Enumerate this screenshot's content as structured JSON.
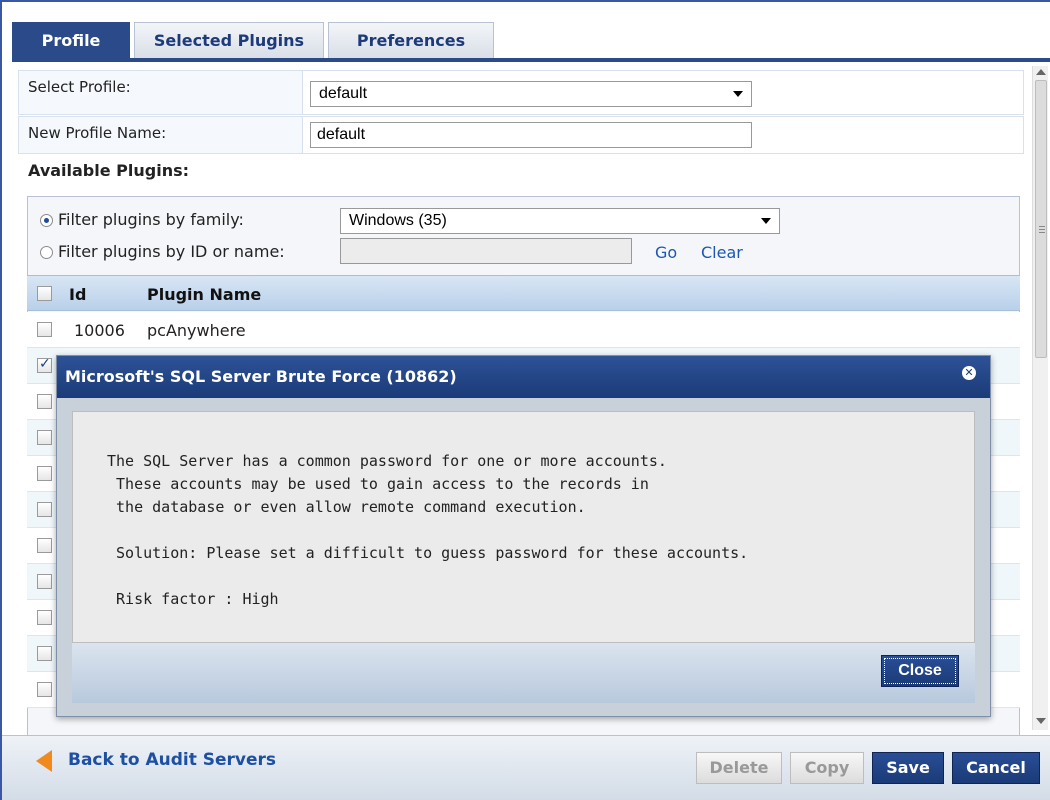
{
  "tabs": [
    {
      "label": "Profile"
    },
    {
      "label": "Selected Plugins"
    },
    {
      "label": "Preferences"
    }
  ],
  "form": {
    "select_profile_label": "Select Profile:",
    "select_profile_value": "default",
    "new_profile_label": "New Profile Name:",
    "new_profile_value": "default",
    "available_plugins_title": "Available Plugins:"
  },
  "filter": {
    "by_family_label": "Filter plugins by family:",
    "family_value": "Windows (35)",
    "by_id_label": "Filter plugins by ID or name:",
    "id_value": "",
    "go_label": "Go",
    "clear_label": "Clear"
  },
  "table": {
    "headers": {
      "id": "Id",
      "name": "Plugin Name"
    },
    "rows": [
      {
        "id": "10006",
        "name": "pcAnywhere",
        "checked": false
      },
      {
        "id": "",
        "name": "",
        "checked": true
      },
      {
        "id": "",
        "name": "",
        "checked": false
      },
      {
        "id": "",
        "name": "",
        "checked": false
      },
      {
        "id": "",
        "name": "",
        "checked": false
      },
      {
        "id": "",
        "name": "",
        "checked": false
      },
      {
        "id": "",
        "name": "",
        "checked": false
      },
      {
        "id": "",
        "name": "",
        "checked": false
      },
      {
        "id": "",
        "name": "",
        "checked": false
      },
      {
        "id": "",
        "name": "",
        "checked": false
      }
    ]
  },
  "modal": {
    "title": "Microsoft's SQL Server Brute Force (10862)",
    "body": "The SQL Server has a common password for one or more accounts.\n These accounts may be used to gain access to the records in\n the database or even allow remote command execution.\n\n Solution: Please set a difficult to guess password for these accounts.\n\n Risk factor : High",
    "close_label": "Close"
  },
  "footer": {
    "back_label": "Back to Audit Servers",
    "delete_label": "Delete",
    "copy_label": "Copy",
    "save_label": "Save",
    "cancel_label": "Cancel"
  },
  "colors": {
    "accent": "#2a4a8a",
    "link": "#1d56b5",
    "back_arrow": "#f08a1c"
  }
}
